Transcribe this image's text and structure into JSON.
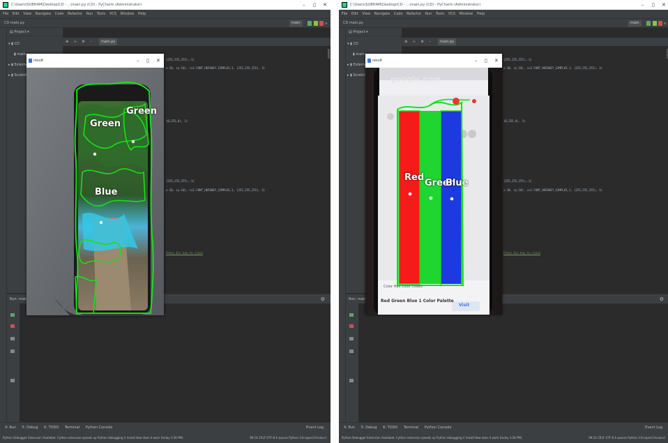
{
  "ide": {
    "title": "C:\\Users\\SUBHAM\\Desktop\\CD - ...\\main.py (CD) - PyCharm (Administrator)",
    "menu": [
      "File",
      "Edit",
      "View",
      "Navigate",
      "Code",
      "Refactor",
      "Run",
      "Tools",
      "VCS",
      "Window",
      "Help"
    ],
    "breadcrumb": "CD  main.py",
    "branch": "main",
    "project_label": "Project",
    "tree": [
      "CD",
      "main",
      "External",
      "Scratches"
    ],
    "editor_tab": "main.py",
    "code_lines": [
      "(255,255,255),-1)",
      "x-10, cy-10), cv2.FONT_HERSHEY_SIMPLEX,1, (255,255,255), 3)",
      "(0,255,0), 3)",
      "(255,255,255),-1)",
      "x-10, cy-10), cv2.FONT_HERSHEY_SIMPLEX,1, (255,255,255), 3)"
    ],
    "hint": "Press Esc key to close",
    "run_label": "Run",
    "run_config": "main",
    "bottom_tabs": [
      "4: Run",
      "5: Debug",
      "6: TODO",
      "Terminal",
      "Python Console"
    ],
    "event_log": "Event Log",
    "status_message": "Python Debugger Extension Available: Cython extension speeds up Python debugging // Install How does it work (today 3:36 PM)",
    "status_info": "99:14  CRLF  UTF-8  4 spaces  Python 3.8 (openCVcolour)"
  },
  "result_window_title": "result",
  "left_window": {
    "labels": [
      "Green",
      "Green",
      "Blue"
    ]
  },
  "right_window": {
    "labels": [
      "Red",
      "Green",
      "Blue"
    ],
    "url_text": "google.com",
    "caption_small": "Color Hex Color Codes",
    "caption": "Red Green Blue 1 Color Palette",
    "visit": "Visit"
  },
  "colors": {
    "contour": "#18e018",
    "red_bar": "#f51b1b",
    "green_bar": "#1fd630",
    "blue_bar": "#1d39e0",
    "ide_bg": "#2b2b2b",
    "ide_panel": "#3c3f41"
  },
  "icons": [
    "pycharm-icon",
    "run-icon",
    "debug-icon",
    "stop-icon",
    "gear-icon",
    "search-icon"
  ]
}
